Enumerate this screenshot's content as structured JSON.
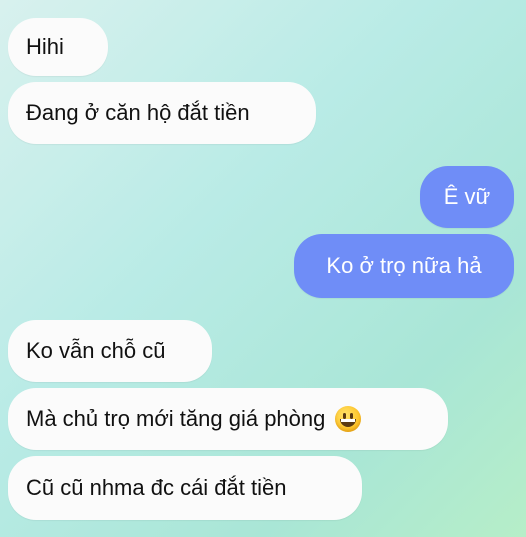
{
  "messages": [
    {
      "side": "incoming",
      "text": "Hihi"
    },
    {
      "side": "incoming",
      "text": "Đang ở căn hộ đắt tiền"
    },
    {
      "side": "outgoing",
      "text": "Ê vữ"
    },
    {
      "side": "outgoing",
      "text": "Ko ở trọ nữa hả"
    },
    {
      "side": "incoming",
      "text": "Ko vẫn chỗ cũ"
    },
    {
      "side": "incoming",
      "text": "Mà chủ trọ mới tăng giá phòng",
      "emoji": "grinning-face-emoji"
    },
    {
      "side": "incoming",
      "text": "Cũ cũ nhma đc cái đắt tiền"
    }
  ],
  "colors": {
    "incoming_bubble": "#fbfbfb",
    "outgoing_bubble": "#6f8df7",
    "incoming_text": "#111111",
    "outgoing_text": "#ffffff"
  }
}
